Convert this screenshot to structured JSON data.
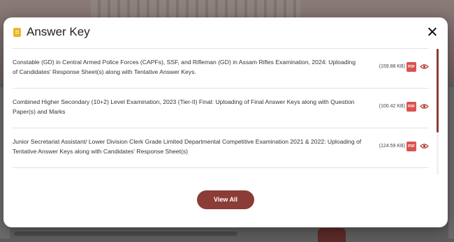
{
  "modal": {
    "title": "Answer Key",
    "view_all_label": "View All"
  },
  "items": [
    {
      "text": "Constable (GD) in Central Armed Police Forces (CAPFs), SSF, and Rifleman (GD) in Assam Rifles Examination, 2024: Uploading of Candidates' Response Sheet(s) along with Tentative Answer Keys.",
      "size": "(159.88 KB)",
      "pdf_label": "PDF"
    },
    {
      "text": "Combined Higher Secondary (10+2) Level Examination, 2023 (Tier-II) Final: Uploading of Final Answer Keys along with Question Paper(s) and Marks",
      "size": "(100.42 KB)",
      "pdf_label": "PDF"
    },
    {
      "text": "Junior Secretariat Assistant/ Lower Division Clerk Grade Limited Departmental Competitive Examination 2021 & 2022: Uploading of Tentative Answer Keys along with Candidates' Response Sheet(s)",
      "size": "(124.59 KB)",
      "pdf_label": "PDF"
    }
  ],
  "colors": {
    "accent": "#8b3c36",
    "icon": "#f0b429",
    "pdf": "#d9534f"
  }
}
